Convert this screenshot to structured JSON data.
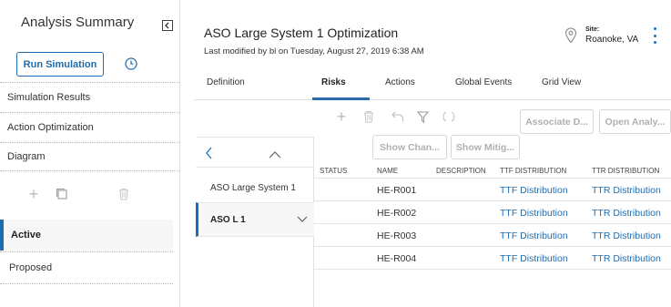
{
  "left": {
    "title": "Analysis Summary",
    "run_button": "Run Simulation",
    "nav_items": [
      "Simulation Results",
      "Action Optimization",
      "Diagram"
    ],
    "states": [
      "Active",
      "Proposed"
    ]
  },
  "header": {
    "title": "ASO Large System 1 Optimization",
    "subtitle": "Last modified by bl on Tuesday, August 27, 2019 6:38 AM",
    "site_label": "Site:",
    "site_value": "Roanoke, VA"
  },
  "tabs": [
    "Definition",
    "Risks",
    "Actions",
    "Global Events",
    "Grid View"
  ],
  "active_tab": "Risks",
  "toolbar": {
    "associate": "Associate D...",
    "open_analysis": "Open Analy...",
    "show_chan": "Show Chan...",
    "show_mitig": "Show Mitig..."
  },
  "tree": {
    "items": [
      "ASO Large System 1",
      "ASO L 1"
    ],
    "selected": "ASO L 1"
  },
  "grid": {
    "columns": [
      "STATUS",
      "NAME",
      "DESCRIPTION",
      "TTF DISTRIBUTION",
      "TTR DISTRIBUTION"
    ],
    "rows": [
      {
        "status": "",
        "name": "HE-R001",
        "description": "",
        "ttf": "TTF Distribution",
        "ttr": "TTR Distribution"
      },
      {
        "status": "",
        "name": "HE-R002",
        "description": "",
        "ttf": "TTF Distribution",
        "ttr": "TTR Distribution"
      },
      {
        "status": "",
        "name": "HE-R003",
        "description": "",
        "ttf": "TTF Distribution",
        "ttr": "TTR Distribution"
      },
      {
        "status": "",
        "name": "HE-R004",
        "description": "",
        "ttf": "TTF Distribution",
        "ttr": "TTR Distribution"
      }
    ]
  },
  "colors": {
    "accent": "#1f6db0",
    "tab_underline": "#2b6cb0",
    "disabled": "#b0b0b0"
  }
}
